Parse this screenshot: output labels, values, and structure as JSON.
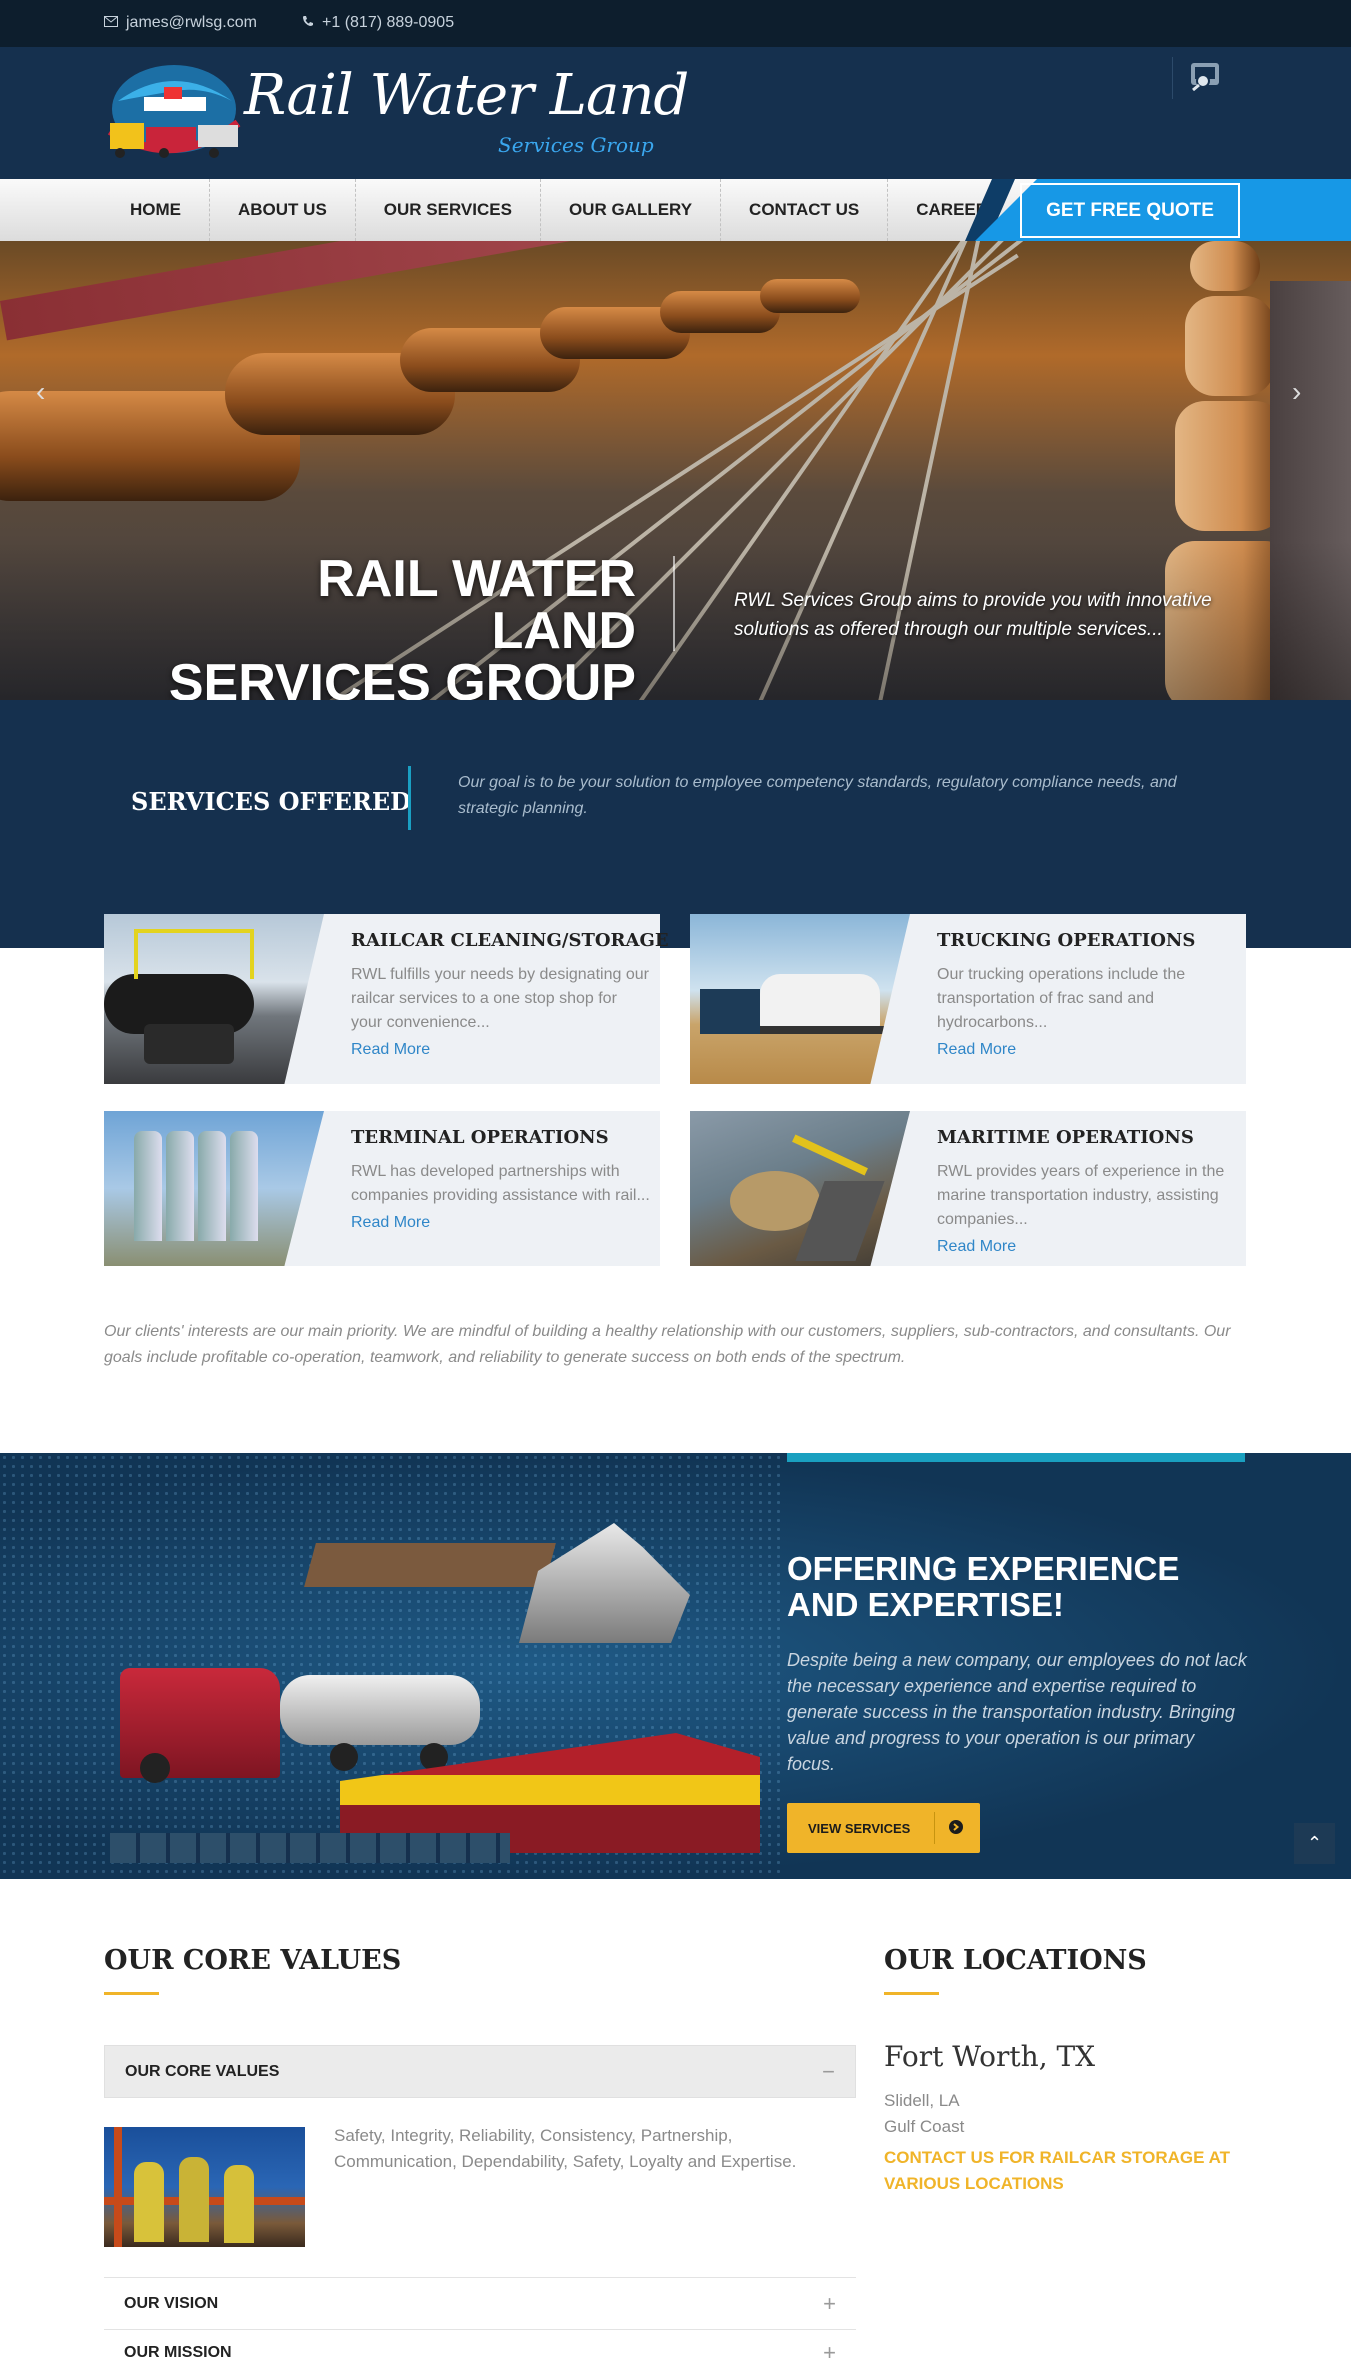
{
  "topbar": {
    "email": "james@rwlsg.com",
    "phone": "+1 (817) 889-0905"
  },
  "logo": {
    "title": "Rail Water Land",
    "subtitle": "Services Group"
  },
  "nav": {
    "items": [
      "HOME",
      "ABOUT US",
      "OUR SERVICES",
      "OUR GALLERY",
      "CONTACT US",
      "CAREERS"
    ],
    "cta": "GET FREE QUOTE"
  },
  "hero": {
    "title_line1": "RAIL WATER LAND",
    "title_line2": "SERVICES GROUP",
    "subtitle": "RWL Services Group aims to provide you with innovative solutions as offered through our multiple services..."
  },
  "services": {
    "heading": "SERVICES OFFERED",
    "intro": "Our goal is to be your solution to employee competency standards, regulatory compliance needs, and strategic planning.",
    "cards": [
      {
        "title": "RAILCAR CLEANING/STORAGE",
        "desc": "RWL fulfills your needs by designating our railcar services to a one stop shop for your convenience...",
        "link": "Read More"
      },
      {
        "title": "TRUCKING OPERATIONS",
        "desc": "Our trucking operations include the transportation of frac sand and hydrocarbons...",
        "link": "Read More"
      },
      {
        "title": "TERMINAL OPERATIONS",
        "desc": "RWL has developed partnerships with companies providing assistance with rail...",
        "link": "Read More"
      },
      {
        "title": "MARITIME OPERATIONS",
        "desc": "RWL provides years of experience in the marine transportation industry, assisting companies...",
        "link": "Read More"
      }
    ]
  },
  "clients": "Our clients' interests are our main priority. We are mindful of building a healthy relationship with our customers, suppliers, sub-contractors, and consultants. Our goals include profitable co-operation, teamwork, and reliability to generate success on both ends of the spectrum.",
  "experience": {
    "title": "OFFERING EXPERIENCE AND EXPERTISE!",
    "text": "Despite being a new company, our employees do not lack the necessary experience and expertise required to generate success in the transportation industry. Bringing value and progress to your operation is our primary focus.",
    "button": "VIEW SERVICES"
  },
  "core": {
    "heading": "OUR CORE VALUES",
    "accordion": [
      {
        "label": "OUR CORE VALUES",
        "sign": "−"
      },
      {
        "label": "OUR VISION",
        "sign": "+"
      },
      {
        "label": "OUR MISSION",
        "sign": "+"
      }
    ],
    "text": "Safety, Integrity, Reliability, Consistency, Partnership, Communication, Dependability, Safety, Loyalty and Expertise."
  },
  "locations": {
    "heading": "OUR LOCATIONS",
    "city": "Fort Worth, TX",
    "lines": [
      "Slidell, LA",
      "Gulf Coast"
    ],
    "cta": "CONTACT US FOR RAILCAR STORAGE AT VARIOUS LOCATIONS"
  },
  "colors": {
    "navy": "#15304e",
    "accent_blue": "#1798e6",
    "gold": "#f0b429",
    "teal": "#1aa0c0",
    "link": "#2f86c8"
  }
}
